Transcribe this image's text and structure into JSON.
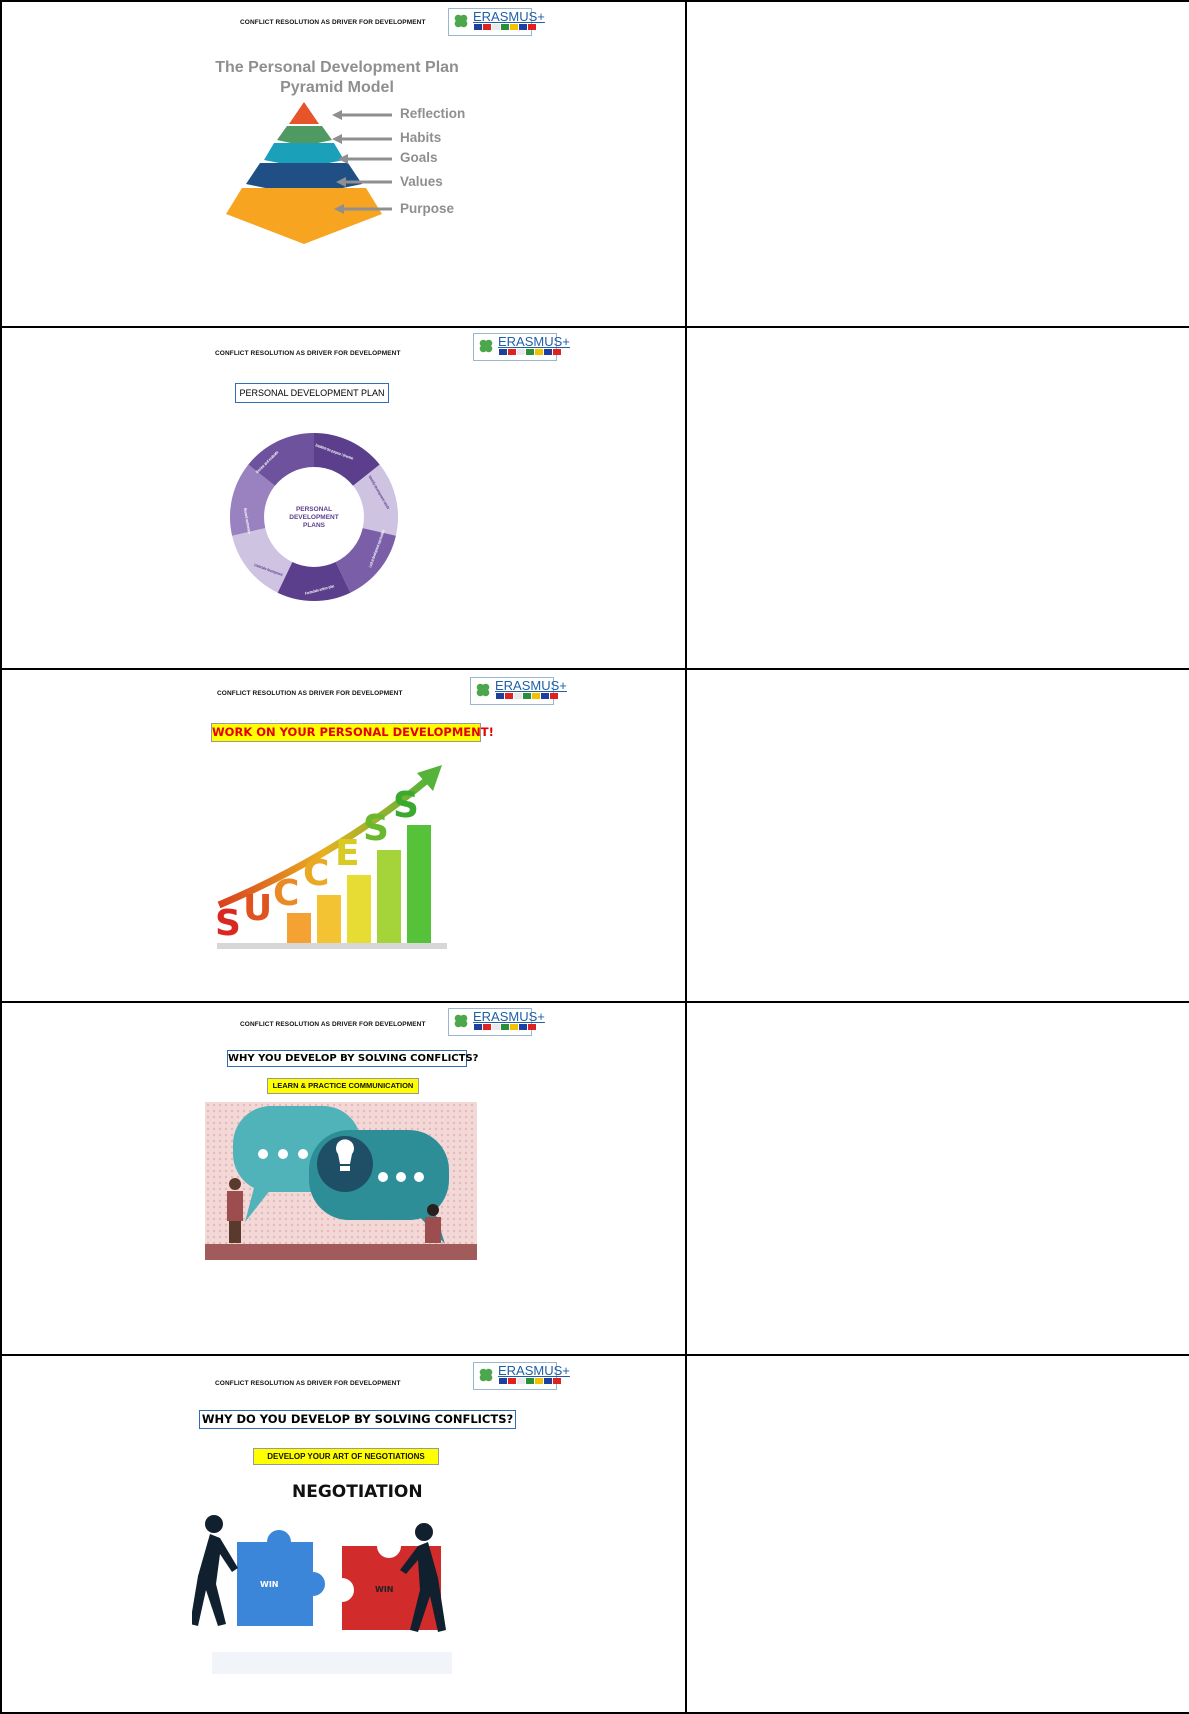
{
  "header_text": "CONFLICT RESOLUTION AS DRIVER FOR DEVELOPMENT",
  "logo_text": "ERASMUS+",
  "slides": [
    {
      "title_line1": "The Personal Development Plan",
      "title_line2": "Pyramid Model",
      "levels": [
        "Reflection",
        "Habits",
        "Goals",
        "Values",
        "Purpose"
      ]
    },
    {
      "box_title": "PERSONAL DEVELOPMENT PLAN",
      "center_text": [
        "PERSONAL",
        "DEVELOPMENT",
        "PLANS"
      ],
      "segments": [
        "Establish the purpose / direction",
        "Identify development needs",
        "Look at development opportunities",
        "Formulate action plan",
        "Undertake development",
        "Record outcomes",
        "Review and evaluate"
      ]
    },
    {
      "banner": "WORK ON YOUR PERSONAL DEVELOPMENT!",
      "letters": [
        "S",
        "U",
        "C",
        "C",
        "E",
        "S",
        "S"
      ]
    },
    {
      "box_title": "WHY YOU DEVELOP BY SOLVING CONFLICTS?",
      "subtitle": "LEARN & PRACTICE COMMUNICATION"
    },
    {
      "box_title": "WHY DO YOU DEVELOP BY SOLVING CONFLICTS?",
      "subtitle": "DEVELOP YOUR ART OF NEGOTIATIONS",
      "illustration_title": "NEGOTIATION",
      "piece_left": "WIN",
      "piece_right": "WIN"
    }
  ],
  "colors": {
    "pyramid": [
      "#e8542a",
      "#4f9a63",
      "#1aa0b9",
      "#1f4f85",
      "#f7a521"
    ],
    "cycle_dark": "#5b3f8c",
    "cycle_light": "#cfc3e2",
    "teal": "#4fb3b9",
    "puzzle_blue": "#3b86d8",
    "puzzle_red": "#d12b2b"
  }
}
